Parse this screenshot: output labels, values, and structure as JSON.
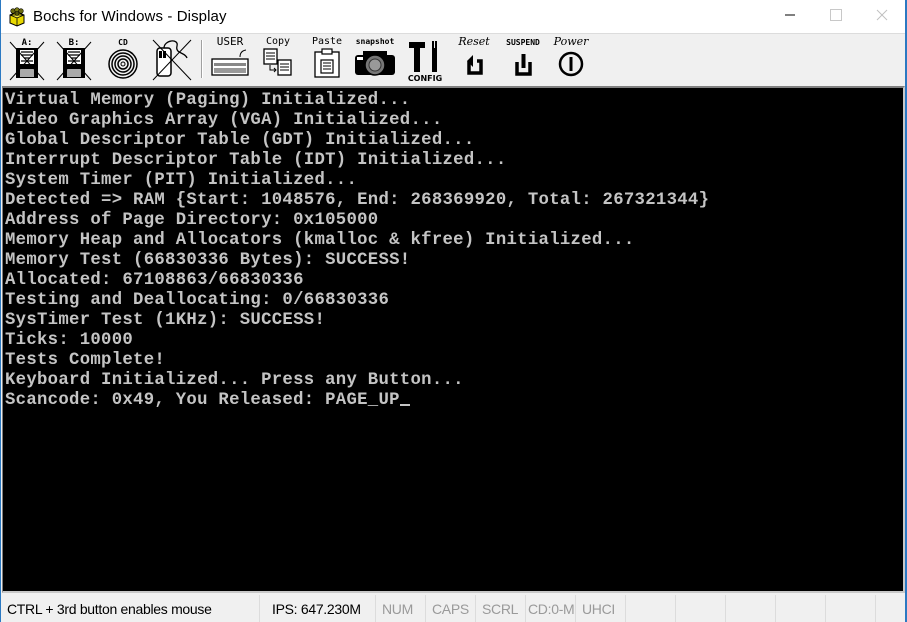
{
  "window": {
    "title": "Bochs for Windows - Display",
    "controls": {
      "minimize": "minimize-icon",
      "maximize": "maximize-icon",
      "close": "close-icon"
    }
  },
  "toolbar": {
    "buttons": [
      {
        "id": "floppy-a",
        "label": "A:",
        "icon": "floppy-disk-icon",
        "state": "disabled"
      },
      {
        "id": "floppy-b",
        "label": "B:",
        "icon": "floppy-disk-icon",
        "state": "disabled"
      },
      {
        "id": "cdrom",
        "label": "CD",
        "icon": "cd-icon",
        "state": "enabled"
      },
      {
        "id": "mouse",
        "label": "",
        "icon": "mouse-icon",
        "state": "disabled"
      },
      {
        "id": "user",
        "label": "USER",
        "icon": "keyboard-icon"
      },
      {
        "id": "copy",
        "label": "Copy",
        "icon": "copy-icon"
      },
      {
        "id": "paste",
        "label": "Paste",
        "icon": "paste-icon"
      },
      {
        "id": "snapshot",
        "label": "snapshot",
        "icon": "camera-icon"
      },
      {
        "id": "config",
        "label": "CONFIG",
        "icon": "tools-icon"
      },
      {
        "id": "reset",
        "label": "Reset",
        "icon": "reset-icon"
      },
      {
        "id": "suspend",
        "label": "SUSPEND",
        "icon": "suspend-icon"
      },
      {
        "id": "power",
        "label": "Power",
        "icon": "power-icon"
      }
    ]
  },
  "console": {
    "lines": [
      "Virtual Memory (Paging) Initialized...",
      "Video Graphics Array (VGA) Initialized...",
      "Global Descriptor Table (GDT) Initialized...",
      "Interrupt Descriptor Table (IDT) Initialized...",
      "System Timer (PIT) Initialized...",
      "Detected => RAM {Start: 1048576, End: 268369920, Total: 267321344}",
      "Address of Page Directory: 0x105000",
      "Memory Heap and Allocators (kmalloc & kfree) Initialized...",
      "Memory Test (66830336 Bytes): SUCCESS!",
      "Allocated: 67108863/66830336",
      "Testing and Deallocating: 0/66830336",
      "SysTimer Test (1KHz): SUCCESS!",
      "Ticks: 10000",
      "Tests Complete!",
      "Keyboard Initialized... Press any Button...",
      "Scancode: 0x49, You Released: PAGE_UP"
    ],
    "text_color": "#c4c4c4",
    "background": "#000000"
  },
  "statusbar": {
    "message": "CTRL + 3rd button enables mouse",
    "ips": "IPS: 647.230M",
    "num": "NUM",
    "caps": "CAPS",
    "scrl": "SCRL",
    "cd": "CD:0-M",
    "uhci": "UHCI"
  }
}
